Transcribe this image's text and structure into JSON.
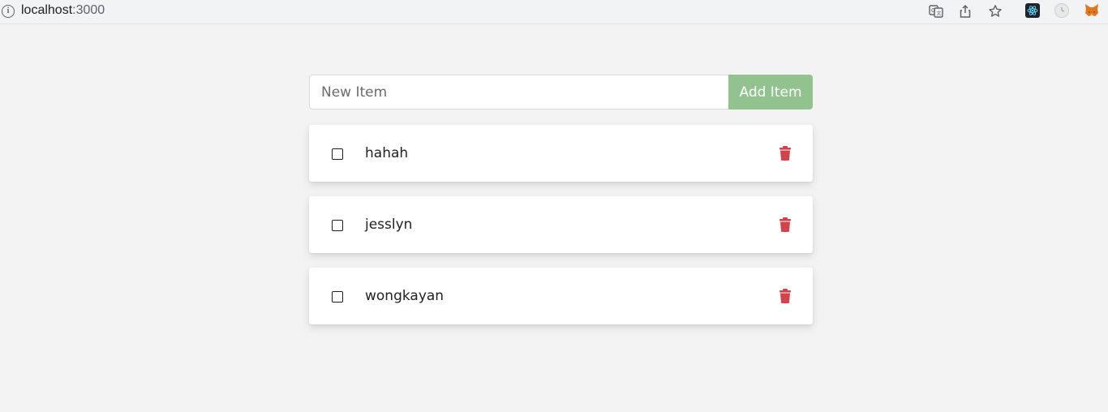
{
  "browser": {
    "url_host": "localhost",
    "url_port": ":3000",
    "info_icon": "info-icon",
    "toolbar_icons": [
      "translate-icon",
      "share-icon",
      "star-icon",
      "react-devtools-icon",
      "clock-extension-icon",
      "metamask-fox-icon"
    ]
  },
  "form": {
    "input_placeholder": "New Item",
    "input_value": "",
    "add_label": "Add Item"
  },
  "items": [
    {
      "text": "hahah",
      "checked": false
    },
    {
      "text": "jesslyn",
      "checked": false
    },
    {
      "text": "wongkayan",
      "checked": false
    }
  ],
  "colors": {
    "add_button": "#92c38e",
    "delete_icon": "#d0454c",
    "page_background": "#f3f3f3"
  }
}
